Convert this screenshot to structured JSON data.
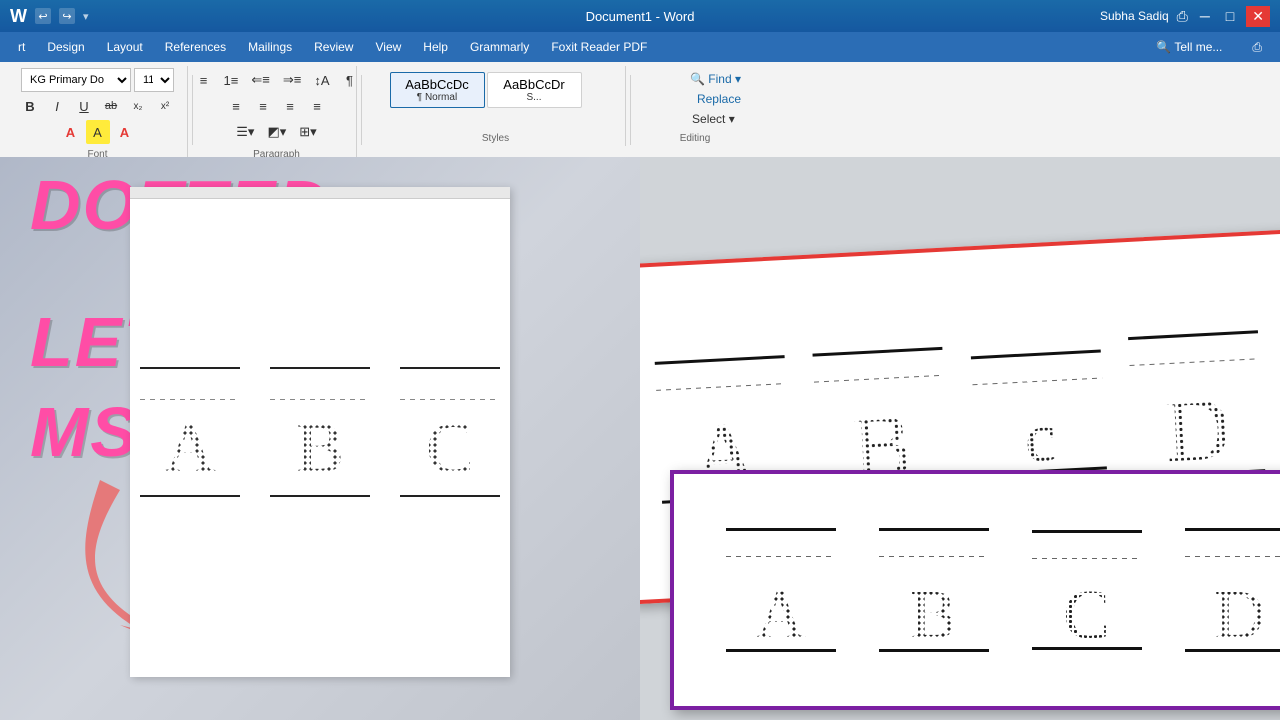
{
  "title_bar": {
    "title": "Document1 - Word",
    "user": "Subha Sadiq",
    "undo_label": "↩",
    "redo_label": "↪"
  },
  "menu": {
    "items": [
      {
        "label": "rt",
        "id": "rt"
      },
      {
        "label": "Design",
        "id": "design"
      },
      {
        "label": "Layout",
        "id": "layout"
      },
      {
        "label": "References",
        "id": "references"
      },
      {
        "label": "Mailings",
        "id": "mailings"
      },
      {
        "label": "Review",
        "id": "review"
      },
      {
        "label": "View",
        "id": "view"
      },
      {
        "label": "Help",
        "id": "help"
      },
      {
        "label": "Grammarly",
        "id": "grammarly"
      },
      {
        "label": "Foxit Reader PDF",
        "id": "foxit"
      },
      {
        "label": "🔍 Tell me...",
        "id": "tell-me"
      }
    ]
  },
  "toolbar": {
    "font_family": "KG Primary Do",
    "font_size": "11",
    "bold": "B",
    "italic": "I",
    "underline": "U",
    "strikethrough": "ab",
    "subscript": "x₂",
    "superscript": "x²",
    "font_color": "A",
    "highlight": "A",
    "font_group_label": "Font",
    "para_group_label": "Paragraph",
    "styles_group_label": "Styles",
    "editing_group_label": "Editing",
    "find_label": "🔍 Find ▾",
    "replace_label": "Replace",
    "select_label": "Select ▾",
    "style1_label": "AaBbCcDc",
    "style1_name": "¶ Normal",
    "style2_label": "AaBbCcDr"
  },
  "overlay": {
    "line1": "DOTTED",
    "line2": "LETTERS IN",
    "line3": "MS WORD"
  },
  "doc_preview": {
    "letters": [
      "A",
      "B",
      "C"
    ]
  },
  "red_doc": {
    "letters": [
      "A",
      "B",
      "c",
      "D"
    ]
  },
  "purple_doc": {
    "letters": [
      "A",
      "B",
      "C",
      "D"
    ]
  },
  "colors": {
    "title_bar_bg": "#1a6aa8",
    "menu_bar_bg": "#2b6db5",
    "ribbon_bg": "#f3f3f3",
    "accent_pink": "#ff4da6",
    "red_border": "#e53935",
    "purple_border": "#7b1fa2"
  }
}
